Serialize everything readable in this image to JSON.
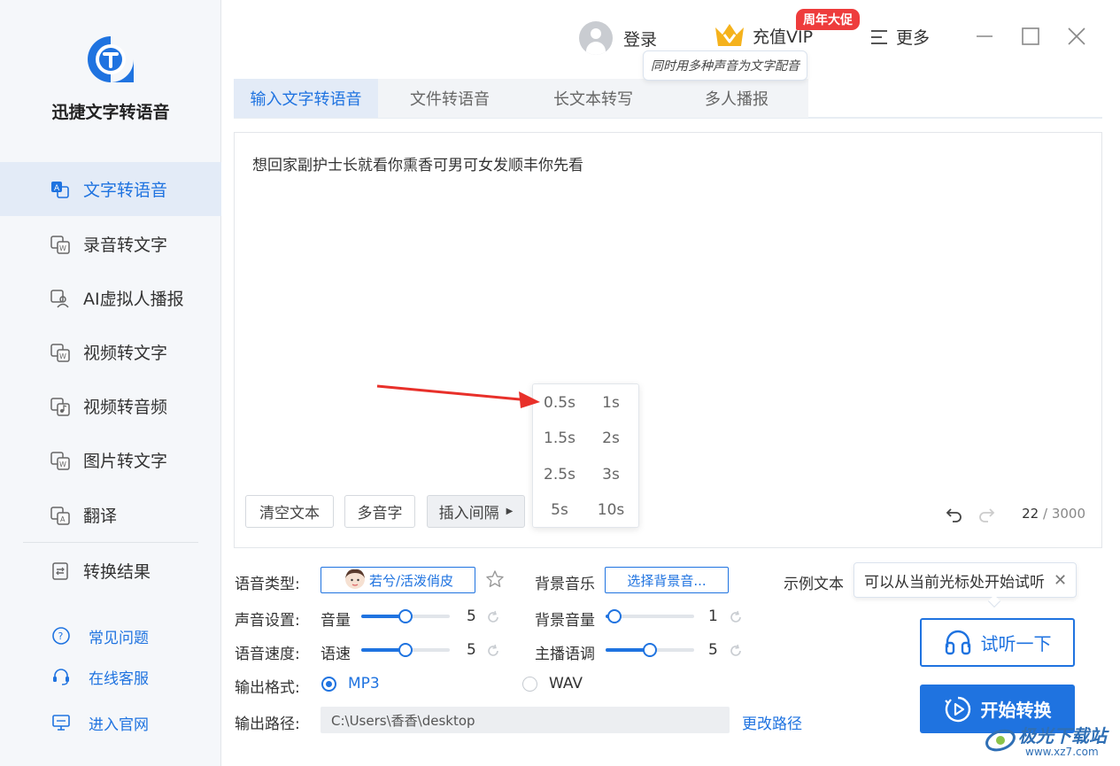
{
  "app": {
    "name": "迅捷文字转语音"
  },
  "sidebar": {
    "items": [
      {
        "label": "文字转语音",
        "icon": "text-to-speech-icon",
        "active": true
      },
      {
        "label": "录音转文字",
        "icon": "audio-to-text-icon",
        "active": false
      },
      {
        "label": "AI虚拟人播报",
        "icon": "ai-avatar-icon",
        "active": false
      },
      {
        "label": "视频转文字",
        "icon": "video-to-text-icon",
        "active": false
      },
      {
        "label": "视频转音频",
        "icon": "video-to-audio-icon",
        "active": false
      },
      {
        "label": "图片转文字",
        "icon": "image-to-text-icon",
        "active": false
      },
      {
        "label": "翻译",
        "icon": "translate-icon",
        "active": false
      },
      {
        "label": "转换结果",
        "icon": "results-icon",
        "active": false
      }
    ],
    "help": [
      {
        "label": "常见问题",
        "icon": "question-icon"
      },
      {
        "label": "在线客服",
        "icon": "headset-icon"
      },
      {
        "label": "进入官网",
        "icon": "monitor-icon"
      }
    ]
  },
  "header": {
    "login_label": "登录",
    "vip_label": "充值VIP",
    "promo_badge": "周年大促",
    "more_label": "更多",
    "tooltip": "同时用多种声音为文字配音"
  },
  "tabs": [
    {
      "label": "输入文字转语音",
      "active": true
    },
    {
      "label": "文件转语音",
      "active": false
    },
    {
      "label": "长文本转写",
      "active": false
    },
    {
      "label": "多人播报",
      "active": false
    }
  ],
  "editor": {
    "text": "想回家副护士长就看你熏香可男可女发顺丰你先看",
    "buttons": {
      "clear": "清空文本",
      "polyphone": "多音字",
      "insert_interval": "插入间隔"
    },
    "char_count": "22",
    "char_max": "/ 3000",
    "interval_options": [
      "0.5s",
      "1s",
      "1.5s",
      "2s",
      "2.5s",
      "3s",
      "5s",
      "10s"
    ]
  },
  "settings": {
    "voice_type_label": "语音类型:",
    "voice_name": "若兮/活泼俏皮",
    "bgm_label": "背景音乐",
    "bgm_button": "选择背景音...",
    "sample_text_label": "示例文本",
    "sound_label": "声音设置:",
    "volume_label": "音量",
    "volume_value": "5",
    "bg_volume_label": "背景音量",
    "bg_volume_value": "1",
    "speed_section_label": "语音速度:",
    "speed_label": "语速",
    "speed_value": "5",
    "pitch_label": "主播语调",
    "pitch_value": "5",
    "format_label": "输出格式:",
    "format_mp3": "MP3",
    "format_wav": "WAV",
    "selected_format": "MP3",
    "path_label": "输出路径:",
    "path_value": "C:\\Users\\香香\\desktop",
    "change_path": "更改路径"
  },
  "levels": {
    "volume": 0.5,
    "bg_volume": 0.1,
    "speed": 0.5,
    "pitch": 0.5,
    "scale_max": 10
  },
  "actions": {
    "tip": "可以从当前光标处开始试听",
    "listen": "试听一下",
    "start": "开始转换"
  },
  "watermark": {
    "name": "极光下载站",
    "url": "www.xz7.com"
  },
  "colors": {
    "accent": "#1f73e0",
    "promo": "#ee3c3c",
    "arrow": "#e8302a"
  }
}
